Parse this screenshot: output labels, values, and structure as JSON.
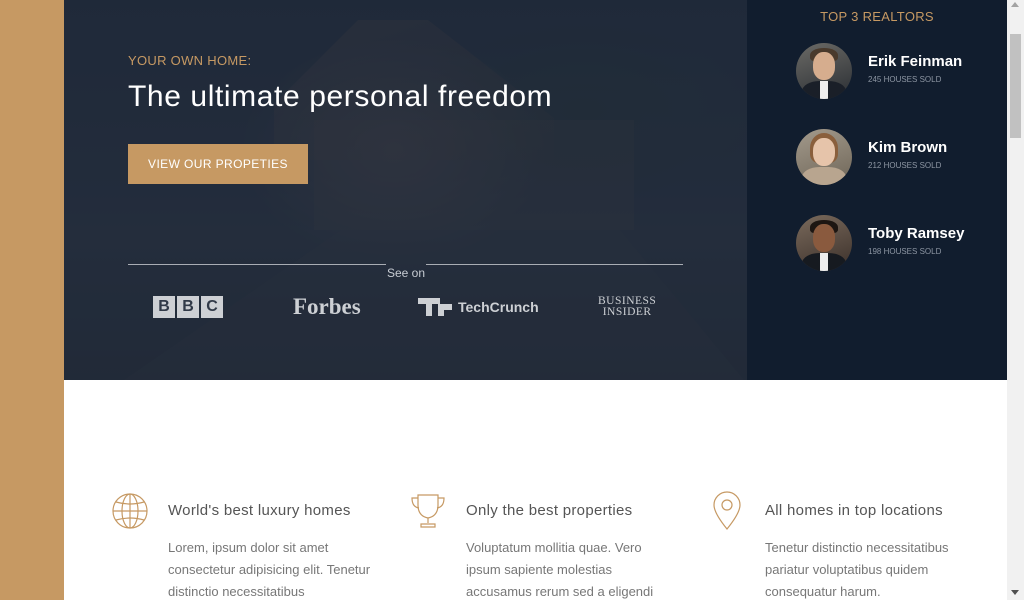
{
  "hero": {
    "subtitle": "Your own home:",
    "title": "The ultimate personal freedom",
    "button_label": "View our propeties",
    "seen_on_label": "See on",
    "logos": {
      "bbc": [
        "B",
        "B",
        "C"
      ],
      "forbes": "Forbes",
      "techcrunch": "TechCrunch",
      "business_insider_line1": "BUSINESS",
      "business_insider_line2": "INSIDER"
    }
  },
  "realtors": {
    "title": "Top 3 Realtors",
    "items": [
      {
        "name": "Erik Feinman",
        "sold": "245 houses sold"
      },
      {
        "name": "Kim Brown",
        "sold": "212 houses sold"
      },
      {
        "name": "Toby Ramsey",
        "sold": "198 houses sold"
      }
    ]
  },
  "features": [
    {
      "icon": "globe-icon",
      "title": "World's best luxury homes",
      "text": "Lorem, ipsum dolor sit amet consectetur adipisicing elit. Tenetur distinctio necessitatibus"
    },
    {
      "icon": "trophy-icon",
      "title": "Only the best properties",
      "text": "Voluptatum mollitia quae. Vero ipsum sapiente molestias accusamus rerum sed a eligendi"
    },
    {
      "icon": "map-pin-icon",
      "title": "All homes in top locations",
      "text": "Tenetur distinctio necessitatibus pariatur voluptatibus quidem consequatur harum."
    }
  ],
  "colors": {
    "accent": "#c69963",
    "dark_navy": "#111d2e",
    "hero_overlay": "#1c2434",
    "text_gray": "#777777"
  }
}
